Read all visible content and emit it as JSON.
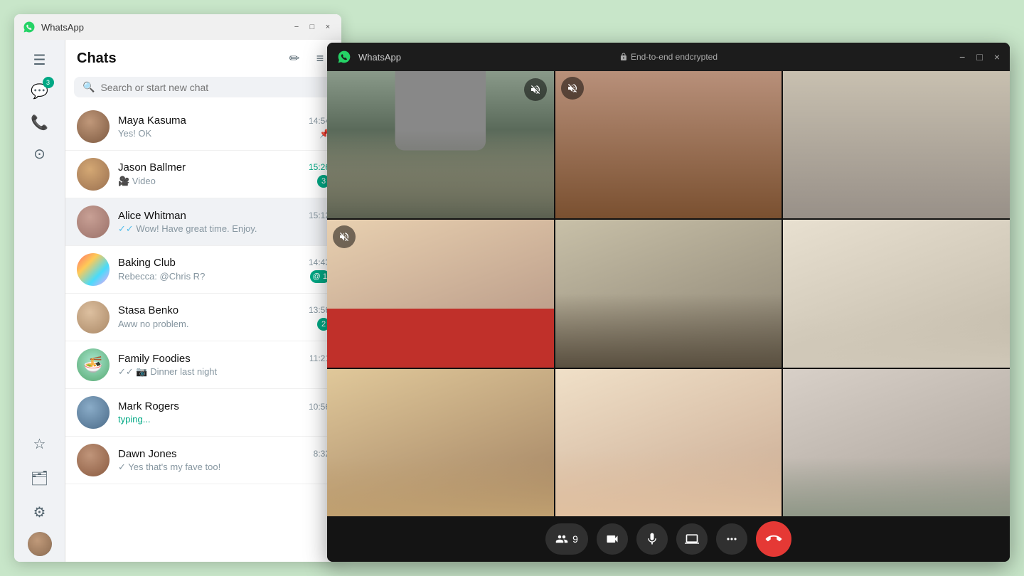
{
  "app": {
    "title": "WhatsApp"
  },
  "window1": {
    "title": "WhatsApp",
    "minimize": "−",
    "maximize": "□",
    "close": "×"
  },
  "sidebar": {
    "chats_badge": "3"
  },
  "chats": {
    "title": "Chats",
    "new_chat_tooltip": "New chat",
    "filter_tooltip": "Filter",
    "search_placeholder": "Search or start new chat",
    "items": [
      {
        "name": "Maya Kasuma",
        "preview": "Yes! OK",
        "time": "14:54",
        "time_green": false,
        "badge": "",
        "pinned": true,
        "read": true,
        "avatar_class": "av-maya"
      },
      {
        "name": "Jason Ballmer",
        "preview": "🎥 Video",
        "time": "15:26",
        "time_green": true,
        "badge": "3",
        "pinned": false,
        "read": false,
        "avatar_class": "av-jason"
      },
      {
        "name": "Alice Whitman",
        "preview": "✓✓ Wow! Have great time. Enjoy.",
        "time": "15:12",
        "time_green": false,
        "badge": "",
        "pinned": false,
        "active": true,
        "read": true,
        "avatar_class": "av-alice"
      },
      {
        "name": "Baking Club",
        "preview": "Rebecca: @Chris R?",
        "time": "14:43",
        "time_green": false,
        "badge": "1",
        "mention": true,
        "avatar_class": "av-baking"
      },
      {
        "name": "Stasa Benko",
        "preview": "Aww no problem.",
        "time": "13:56",
        "time_green": false,
        "badge": "2",
        "avatar_class": "av-stasa"
      },
      {
        "name": "Family Foodies",
        "preview": "✓✓ 📷 Dinner last night",
        "time": "11:21",
        "time_green": false,
        "badge": "",
        "avatar_class": "av-family"
      },
      {
        "name": "Mark Rogers",
        "preview": "typing...",
        "typing": true,
        "time": "10:56",
        "time_green": false,
        "badge": "",
        "avatar_class": "av-mark"
      },
      {
        "name": "Dawn Jones",
        "preview": "✓ Yes that's my fave too!",
        "time": "8:32",
        "time_green": false,
        "badge": "",
        "avatar_class": "av-dawn"
      }
    ]
  },
  "video_call": {
    "title": "WhatsApp",
    "encrypted_label": "End-to-end endcrypted",
    "participants_count": "9",
    "controls": {
      "end_call": "📞",
      "video": "🎥",
      "mic": "🎤",
      "screen": "⬆",
      "more": "•••"
    },
    "people": [
      {
        "id": "p1",
        "muted": false,
        "bg": "p1"
      },
      {
        "id": "p2",
        "muted": true,
        "bg": "p2"
      },
      {
        "id": "p3",
        "muted": false,
        "bg": "p3"
      },
      {
        "id": "p4",
        "muted": true,
        "bg": "p4",
        "active_speaker": false
      },
      {
        "id": "p5",
        "muted": false,
        "bg": "p5",
        "active_speaker": true
      },
      {
        "id": "p6",
        "muted": false,
        "bg": "p6"
      },
      {
        "id": "p7",
        "muted": false,
        "bg": "p7"
      },
      {
        "id": "p8",
        "muted": false,
        "bg": "p8"
      },
      {
        "id": "p9",
        "muted": false,
        "bg": "p9"
      }
    ]
  }
}
